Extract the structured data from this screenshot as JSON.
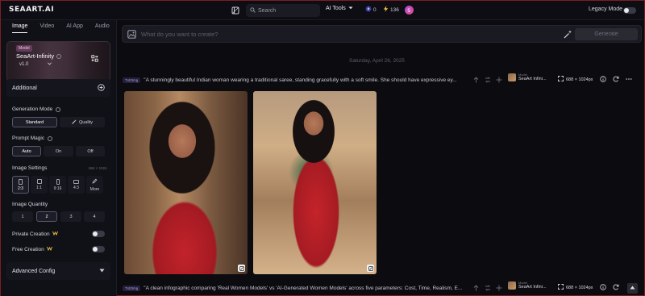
{
  "header": {
    "logo": "SEAART.AI",
    "search_placeholder": "Search",
    "ai_tools_label": "AI Tools",
    "stamina_count": "0",
    "energy_count": "136",
    "legacy_mode_label": "Legacy Mode"
  },
  "sidebar": {
    "tabs": [
      {
        "label": "Image",
        "active": true
      },
      {
        "label": "Video",
        "active": false
      },
      {
        "label": "AI App",
        "active": false
      },
      {
        "label": "Audio",
        "active": false
      }
    ],
    "model": {
      "tag": "Model",
      "name": "SeaArt-Infinity",
      "version": "v1.0"
    },
    "additional_label": "Additional",
    "generation_mode": {
      "label": "Generation Mode",
      "options": [
        "Standard",
        "Quality"
      ],
      "selected": "Standard"
    },
    "prompt_magic": {
      "label": "Prompt Magic",
      "options": [
        "Auto",
        "On",
        "Off"
      ],
      "selected": "Auto"
    },
    "image_settings": {
      "label": "Image Settings",
      "dims": "684 × 1024",
      "ratios": [
        "2:3",
        "1:1",
        "9:16",
        "4:3",
        "More"
      ],
      "selected": "2:3"
    },
    "image_quantity": {
      "label": "Image Quantity",
      "options": [
        "1",
        "2",
        "3",
        "4"
      ],
      "selected": "2"
    },
    "private_creation_label": "Private Creation",
    "free_creation_label": "Free Creation",
    "advanced_config_label": "Advanced Config"
  },
  "main": {
    "prompt_placeholder": "What do you want to create?",
    "generate_label": "Generate",
    "date": "Saturday, April 26, 2025",
    "tasks": [
      {
        "badge": "Txt2Img",
        "prompt": "\"A stunningly beautiful Indian woman wearing a traditional saree, standing gracefully with a soft smile. She should have expressive ey...",
        "model_small": "Model",
        "model_name": "SeaArt Infini...",
        "size": "688 × 1024px"
      },
      {
        "badge": "Txt2Img",
        "prompt": "\"A clean infographic comparing 'Real Women Models' vs 'AI-Generated Women Models' across five parameters: Cost, Time, Realism, E...",
        "model_small": "Model",
        "model_name": "SeaArt Infini...",
        "size": "688 × 1024px"
      }
    ]
  }
}
